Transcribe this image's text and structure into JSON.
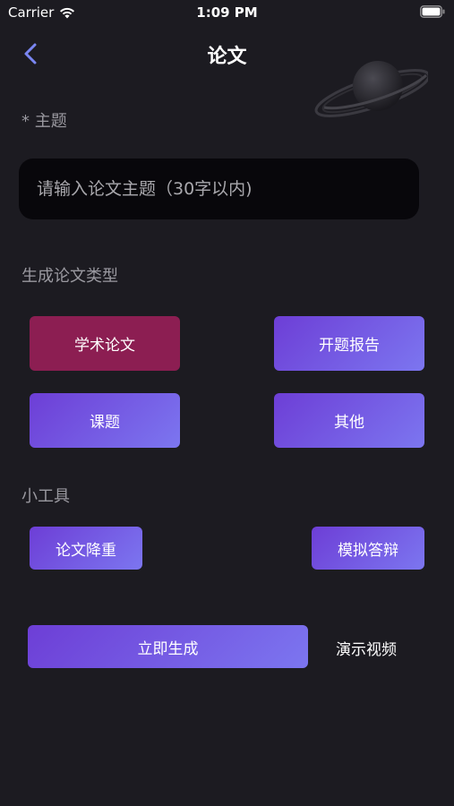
{
  "status": {
    "carrier": "Carrier",
    "time": "1:09 PM"
  },
  "nav": {
    "title": "论文"
  },
  "topic": {
    "label": "* 主题",
    "placeholder": "请输入论文主题（30字以内)"
  },
  "type_section": {
    "label": "生成论文类型",
    "options": [
      "学术论文",
      "开题报告",
      "课题",
      "其他"
    ],
    "selected": "学术论文"
  },
  "tools_section": {
    "label": "小工具",
    "tools": [
      "论文降重",
      "模拟答辩"
    ]
  },
  "actions": {
    "generate": "立即生成",
    "demo": "演示视频"
  },
  "colors": {
    "background": "#1c1b21",
    "selected": "#8c1e52",
    "gradient_start": "#6d3ed6",
    "gradient_end": "#7c76f0",
    "back_arrow": "#7a86f2"
  }
}
